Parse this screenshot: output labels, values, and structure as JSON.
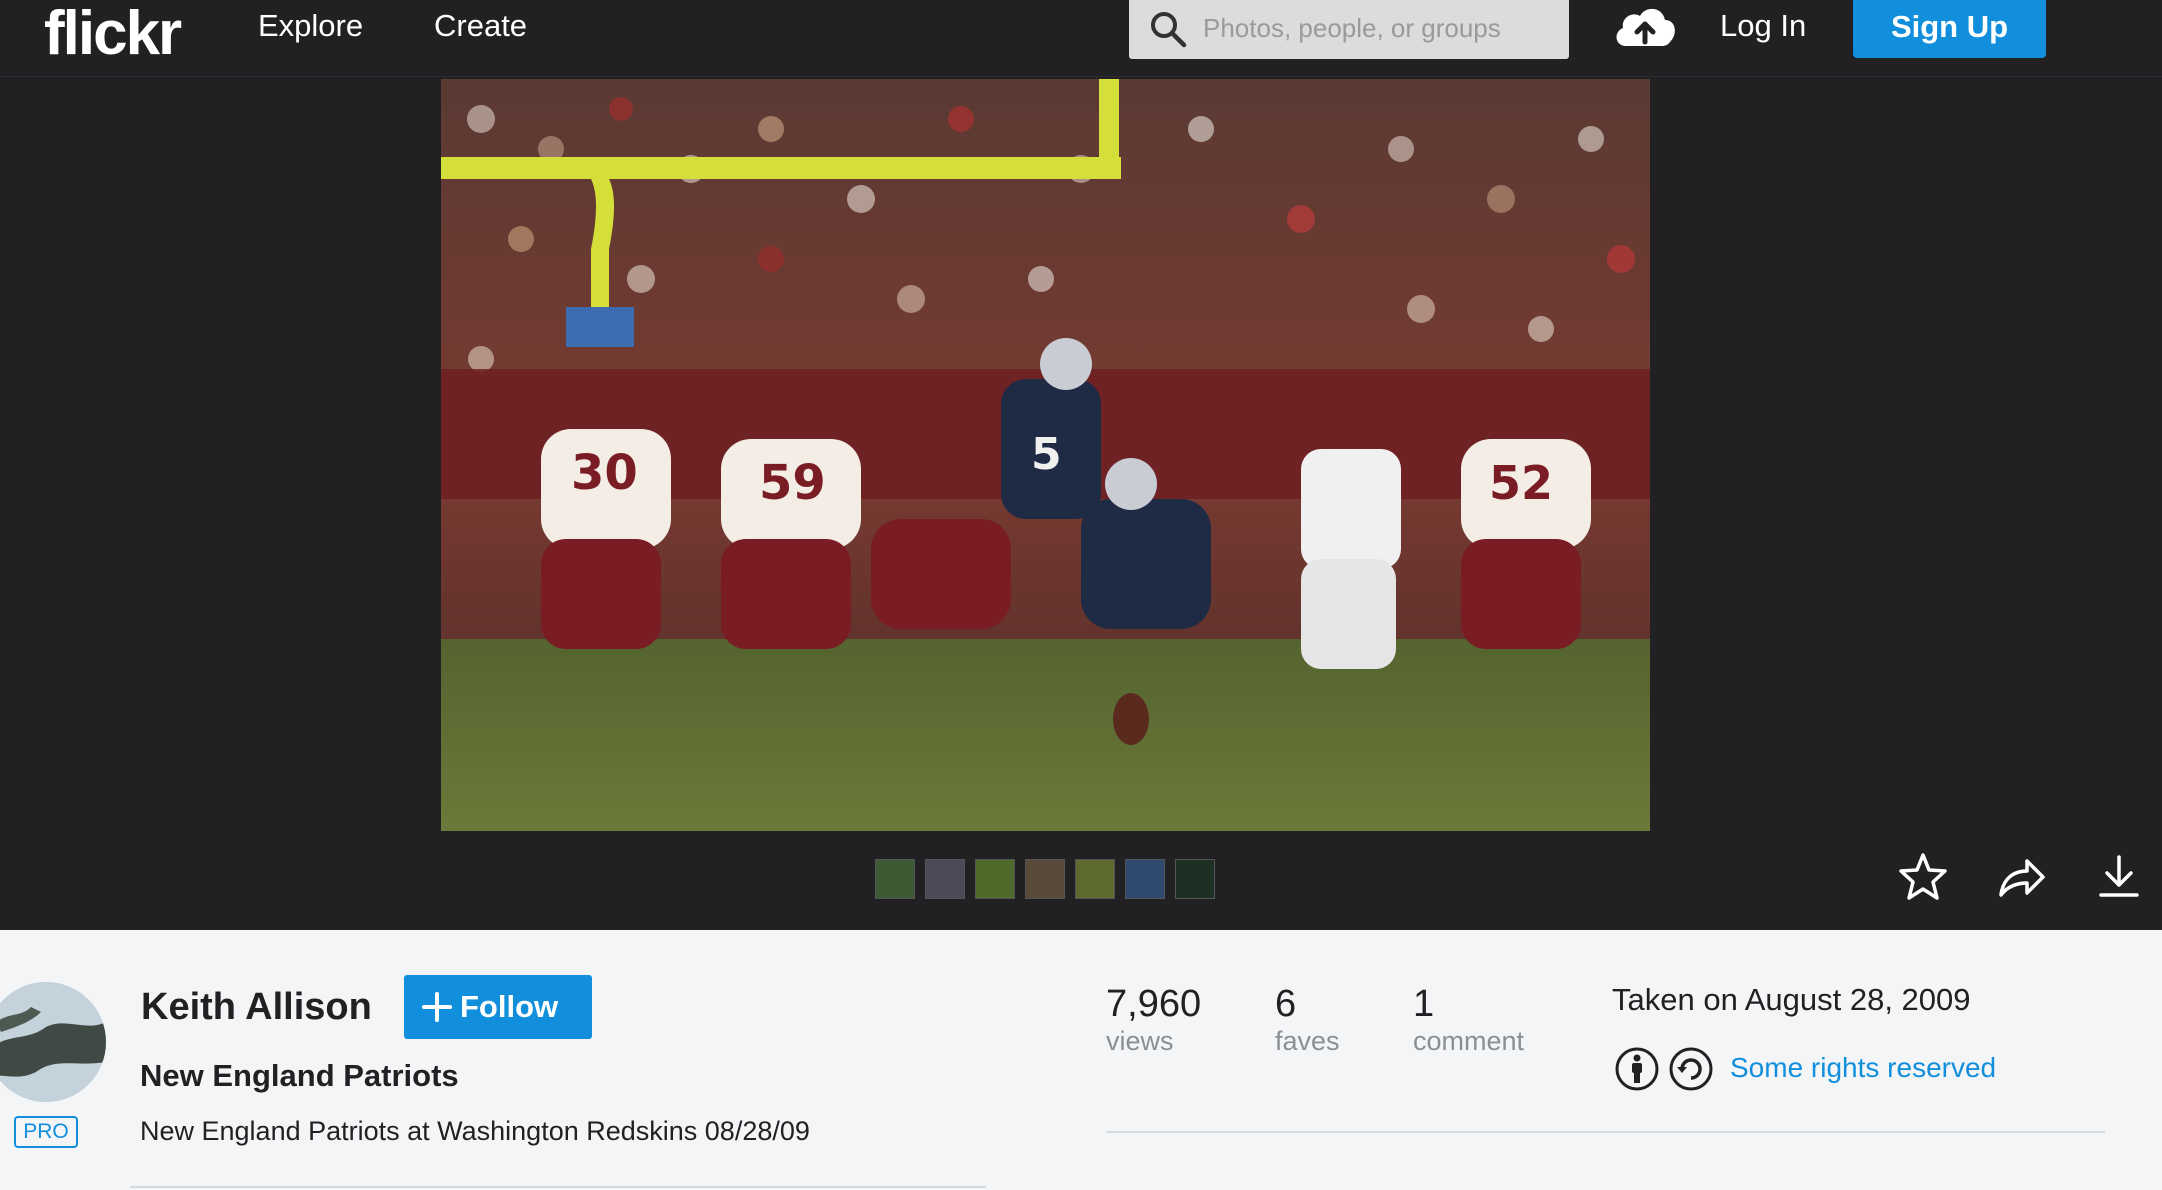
{
  "nav": {
    "logo": "flickr",
    "explore": "Explore",
    "create": "Create",
    "search_placeholder": "Photos, people, or groups",
    "login": "Log In",
    "signup": "Sign Up"
  },
  "thumbnails": [
    "#3d5a35",
    "#4a4a58",
    "#4f6b2c",
    "#5a4a3a",
    "#5d6a30",
    "#2f4a6e",
    "#1e2f24"
  ],
  "actions": {
    "fave_icon": "star-icon",
    "share_icon": "share-icon",
    "download_icon": "download-icon"
  },
  "owner": {
    "name": "Keith Allison",
    "badge": "PRO",
    "follow_label": "Follow"
  },
  "photo": {
    "title": "New England Patriots",
    "description": "New England Patriots at Washington Redskins 08/28/09",
    "taken": "Taken on August 28, 2009",
    "license": "Some rights reserved"
  },
  "stats": [
    {
      "value": "7,960",
      "label": "views"
    },
    {
      "value": "6",
      "label": "faves"
    },
    {
      "value": "1",
      "label": "comment"
    }
  ],
  "colors": {
    "accent": "#128fdc",
    "nav_bg": "#212124",
    "panel_bg": "#f3f5f6"
  }
}
